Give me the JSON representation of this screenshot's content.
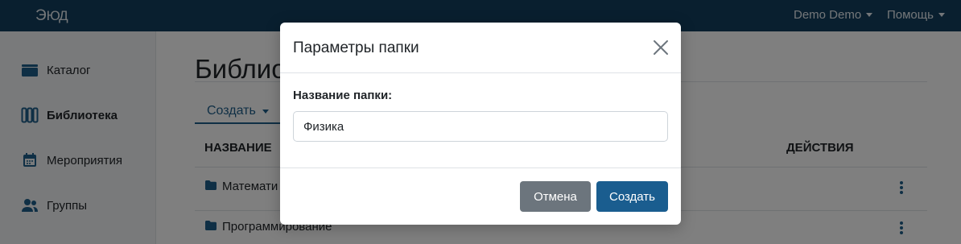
{
  "app": {
    "logo_text_cap": "Э",
    "logo_text_rest": "ЮД"
  },
  "header": {
    "user_menu": "Demo Demo",
    "help_menu": "Помощь"
  },
  "sidebar": {
    "items": [
      {
        "label": "Каталог",
        "icon": "catalog-icon"
      },
      {
        "label": "Библиотека",
        "icon": "library-icon",
        "active": true
      },
      {
        "label": "Мероприятия",
        "icon": "calendar-icon"
      },
      {
        "label": "Группы",
        "icon": "users-icon"
      }
    ]
  },
  "main": {
    "title": "Библио",
    "create_label": "Создать",
    "columns": {
      "name": "НАЗВАНИЕ",
      "actions": "ДЕЙСТВИЯ"
    },
    "rows": [
      {
        "name": "Математи",
        "icon": "folder-icon"
      },
      {
        "name": "Программирование",
        "icon": "folder-icon"
      }
    ]
  },
  "modal": {
    "title": "Параметры папки",
    "field_label": "Название папки:",
    "field_value": "Физика",
    "cancel_label": "Отмена",
    "create_label": "Создать"
  },
  "colors": {
    "header_bg": "#133f5e",
    "accent": "#1a5d8f",
    "cancel_bg": "#6c757d"
  }
}
